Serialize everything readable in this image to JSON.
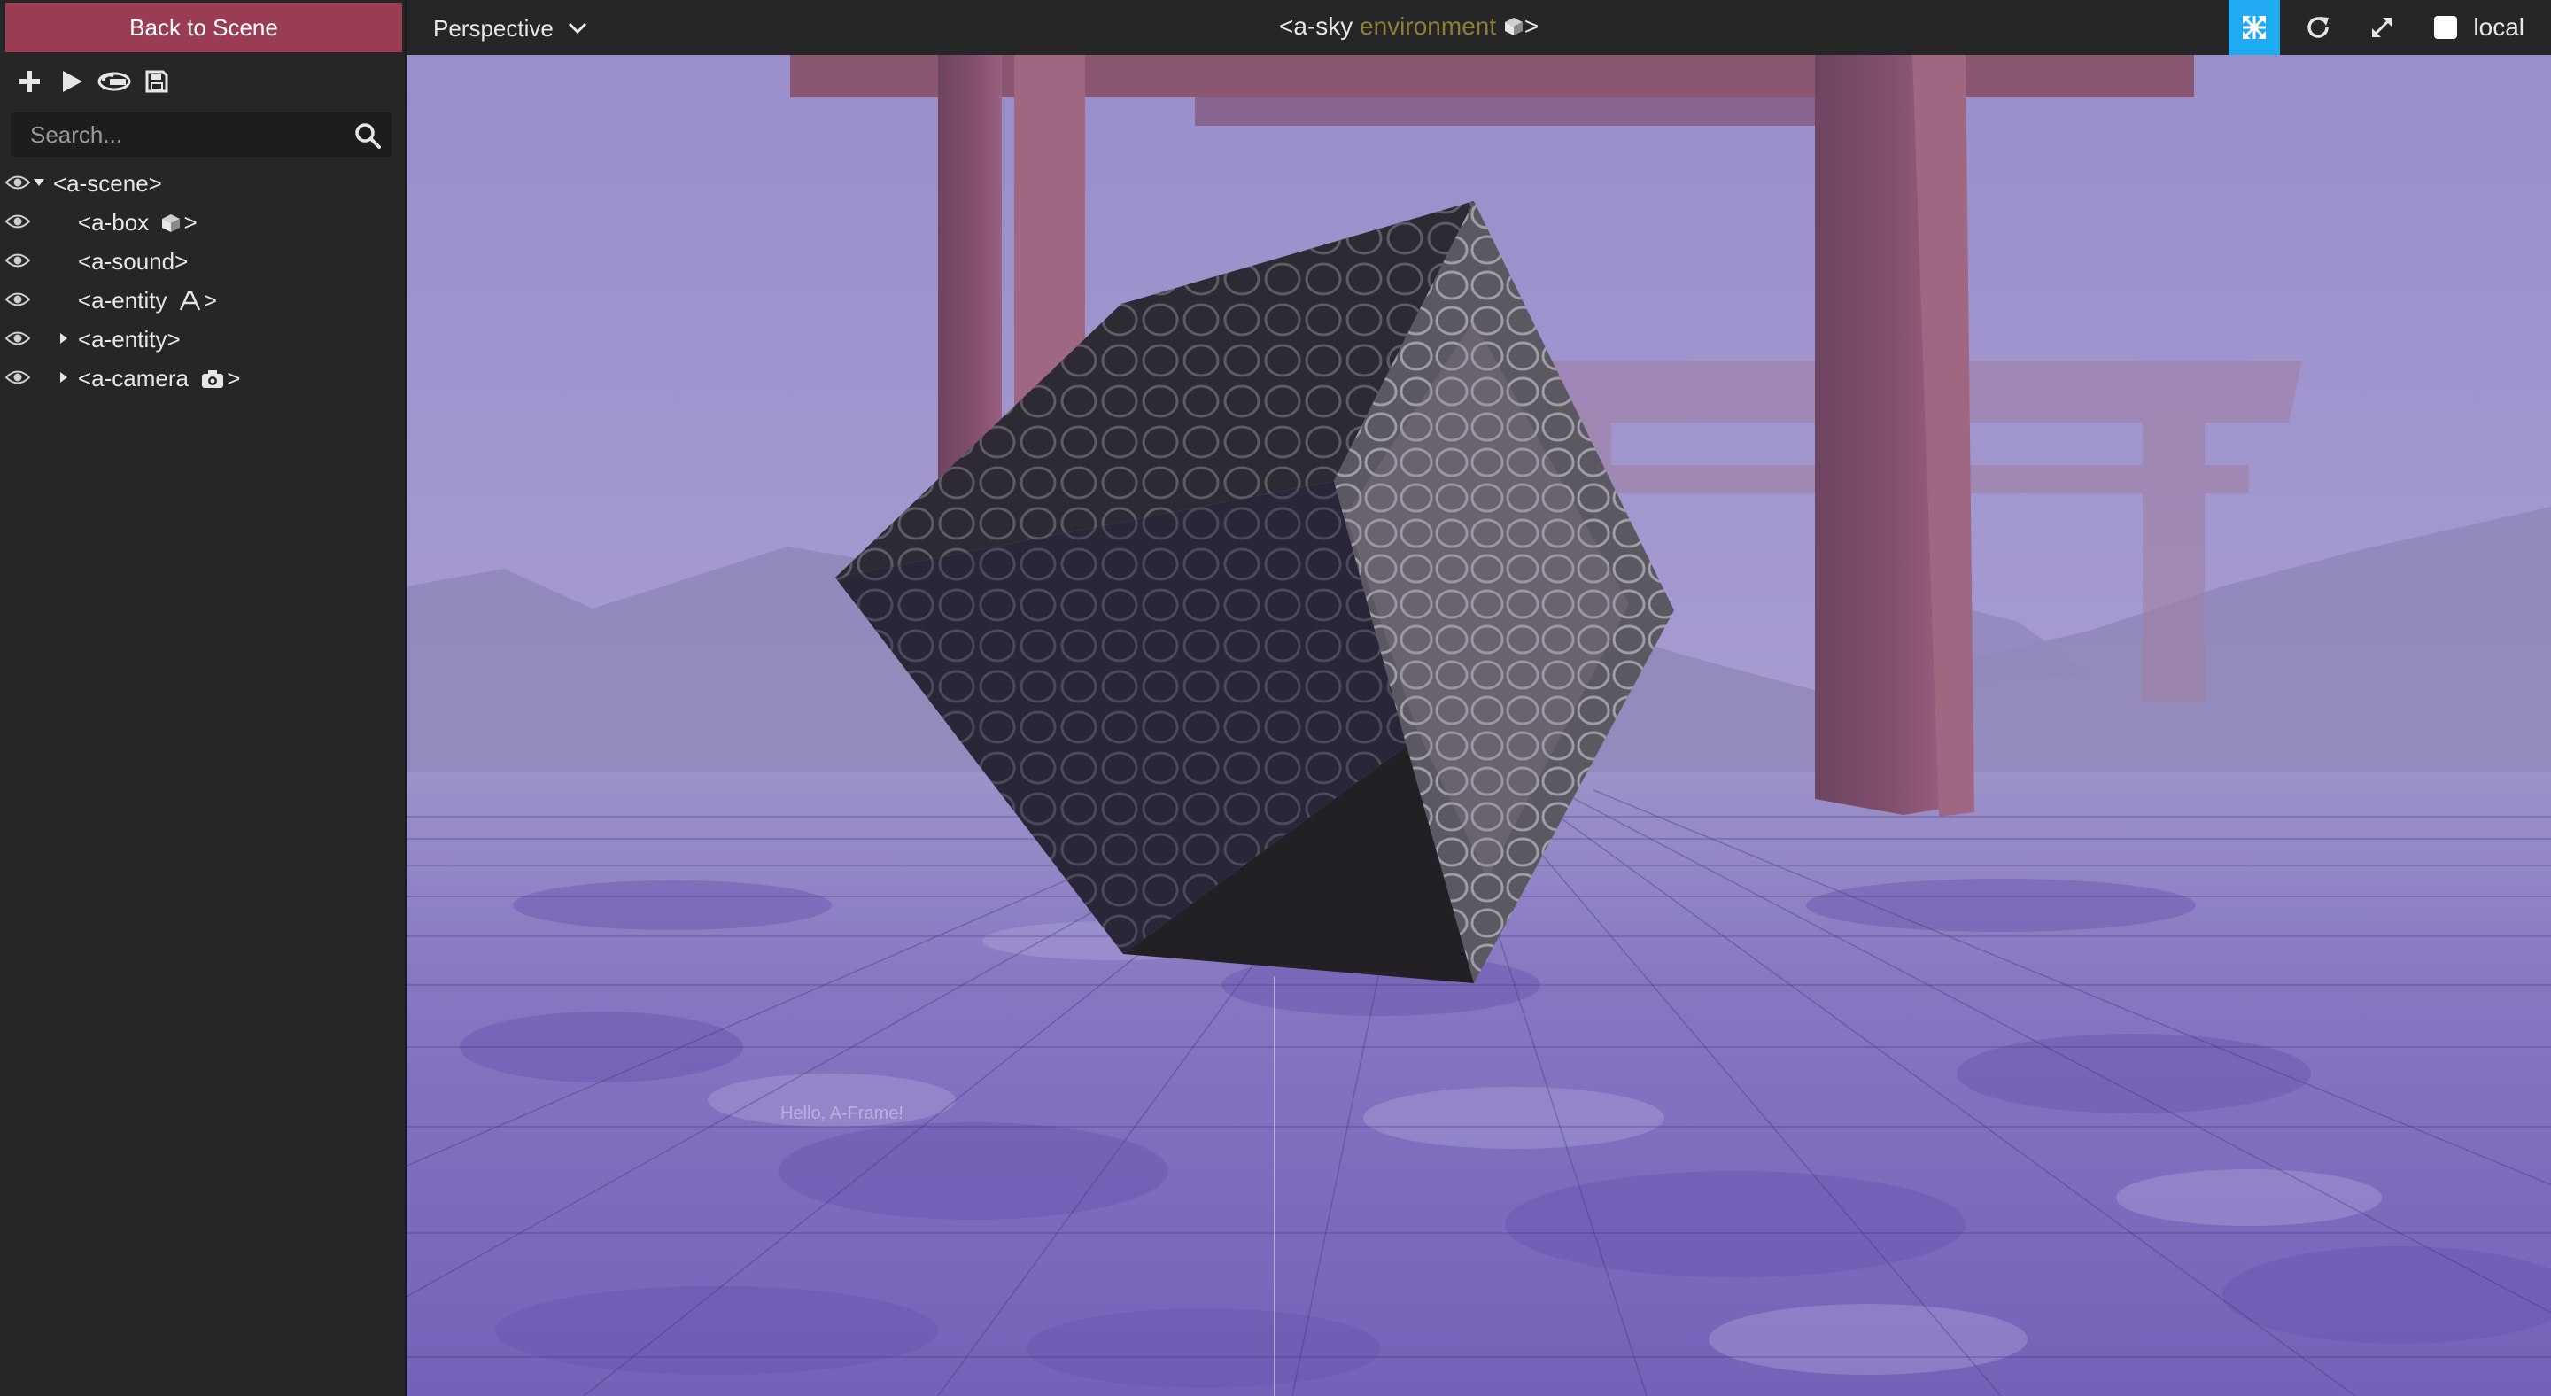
{
  "sidebar": {
    "back_button_label": "Back to Scene",
    "toolbar": [
      {
        "name": "add-entity-button",
        "icon": "plus-icon"
      },
      {
        "name": "play-button",
        "icon": "play-icon"
      },
      {
        "name": "export-gltf-button",
        "icon": "gltf-icon"
      },
      {
        "name": "save-button",
        "icon": "save-icon"
      }
    ],
    "search": {
      "placeholder": "Search...",
      "value": ""
    },
    "outliner": [
      {
        "label": "<a-scene>",
        "expanded": true,
        "depth": 0
      },
      {
        "label": "<a-box",
        "suffix": ">",
        "component_icon": "cube-icon",
        "depth": 1
      },
      {
        "label": "<a-sound>",
        "depth": 1
      },
      {
        "label": "<a-entity",
        "suffix": ">",
        "component_icon": "text-icon",
        "depth": 1
      },
      {
        "label": "<a-entity>",
        "collapsed": true,
        "depth": 1
      },
      {
        "label": "<a-camera",
        "suffix": ">",
        "component_icon": "camera-icon",
        "collapsed": true,
        "depth": 1
      }
    ]
  },
  "topbar": {
    "camera_mode": "Perspective",
    "selected_entity": {
      "tag": "<a-sky",
      "id": "environment",
      "close": ">",
      "icon": "cube-icon"
    },
    "transform_modes": [
      "translate-icon",
      "rotate-icon",
      "scale-icon"
    ],
    "active_mode": "translate",
    "local_label": "local",
    "local_checked": false
  },
  "viewport": {
    "floor_text": "Hello, A-Frame!",
    "sky_color": "#a79bd0",
    "floor_color": "#7a68b8",
    "torii_color": "#8e5a78"
  },
  "colors": {
    "accent_back": "#9b3c55",
    "accent_active": "#1faaf2",
    "entity_id": "#8b7f3a"
  }
}
